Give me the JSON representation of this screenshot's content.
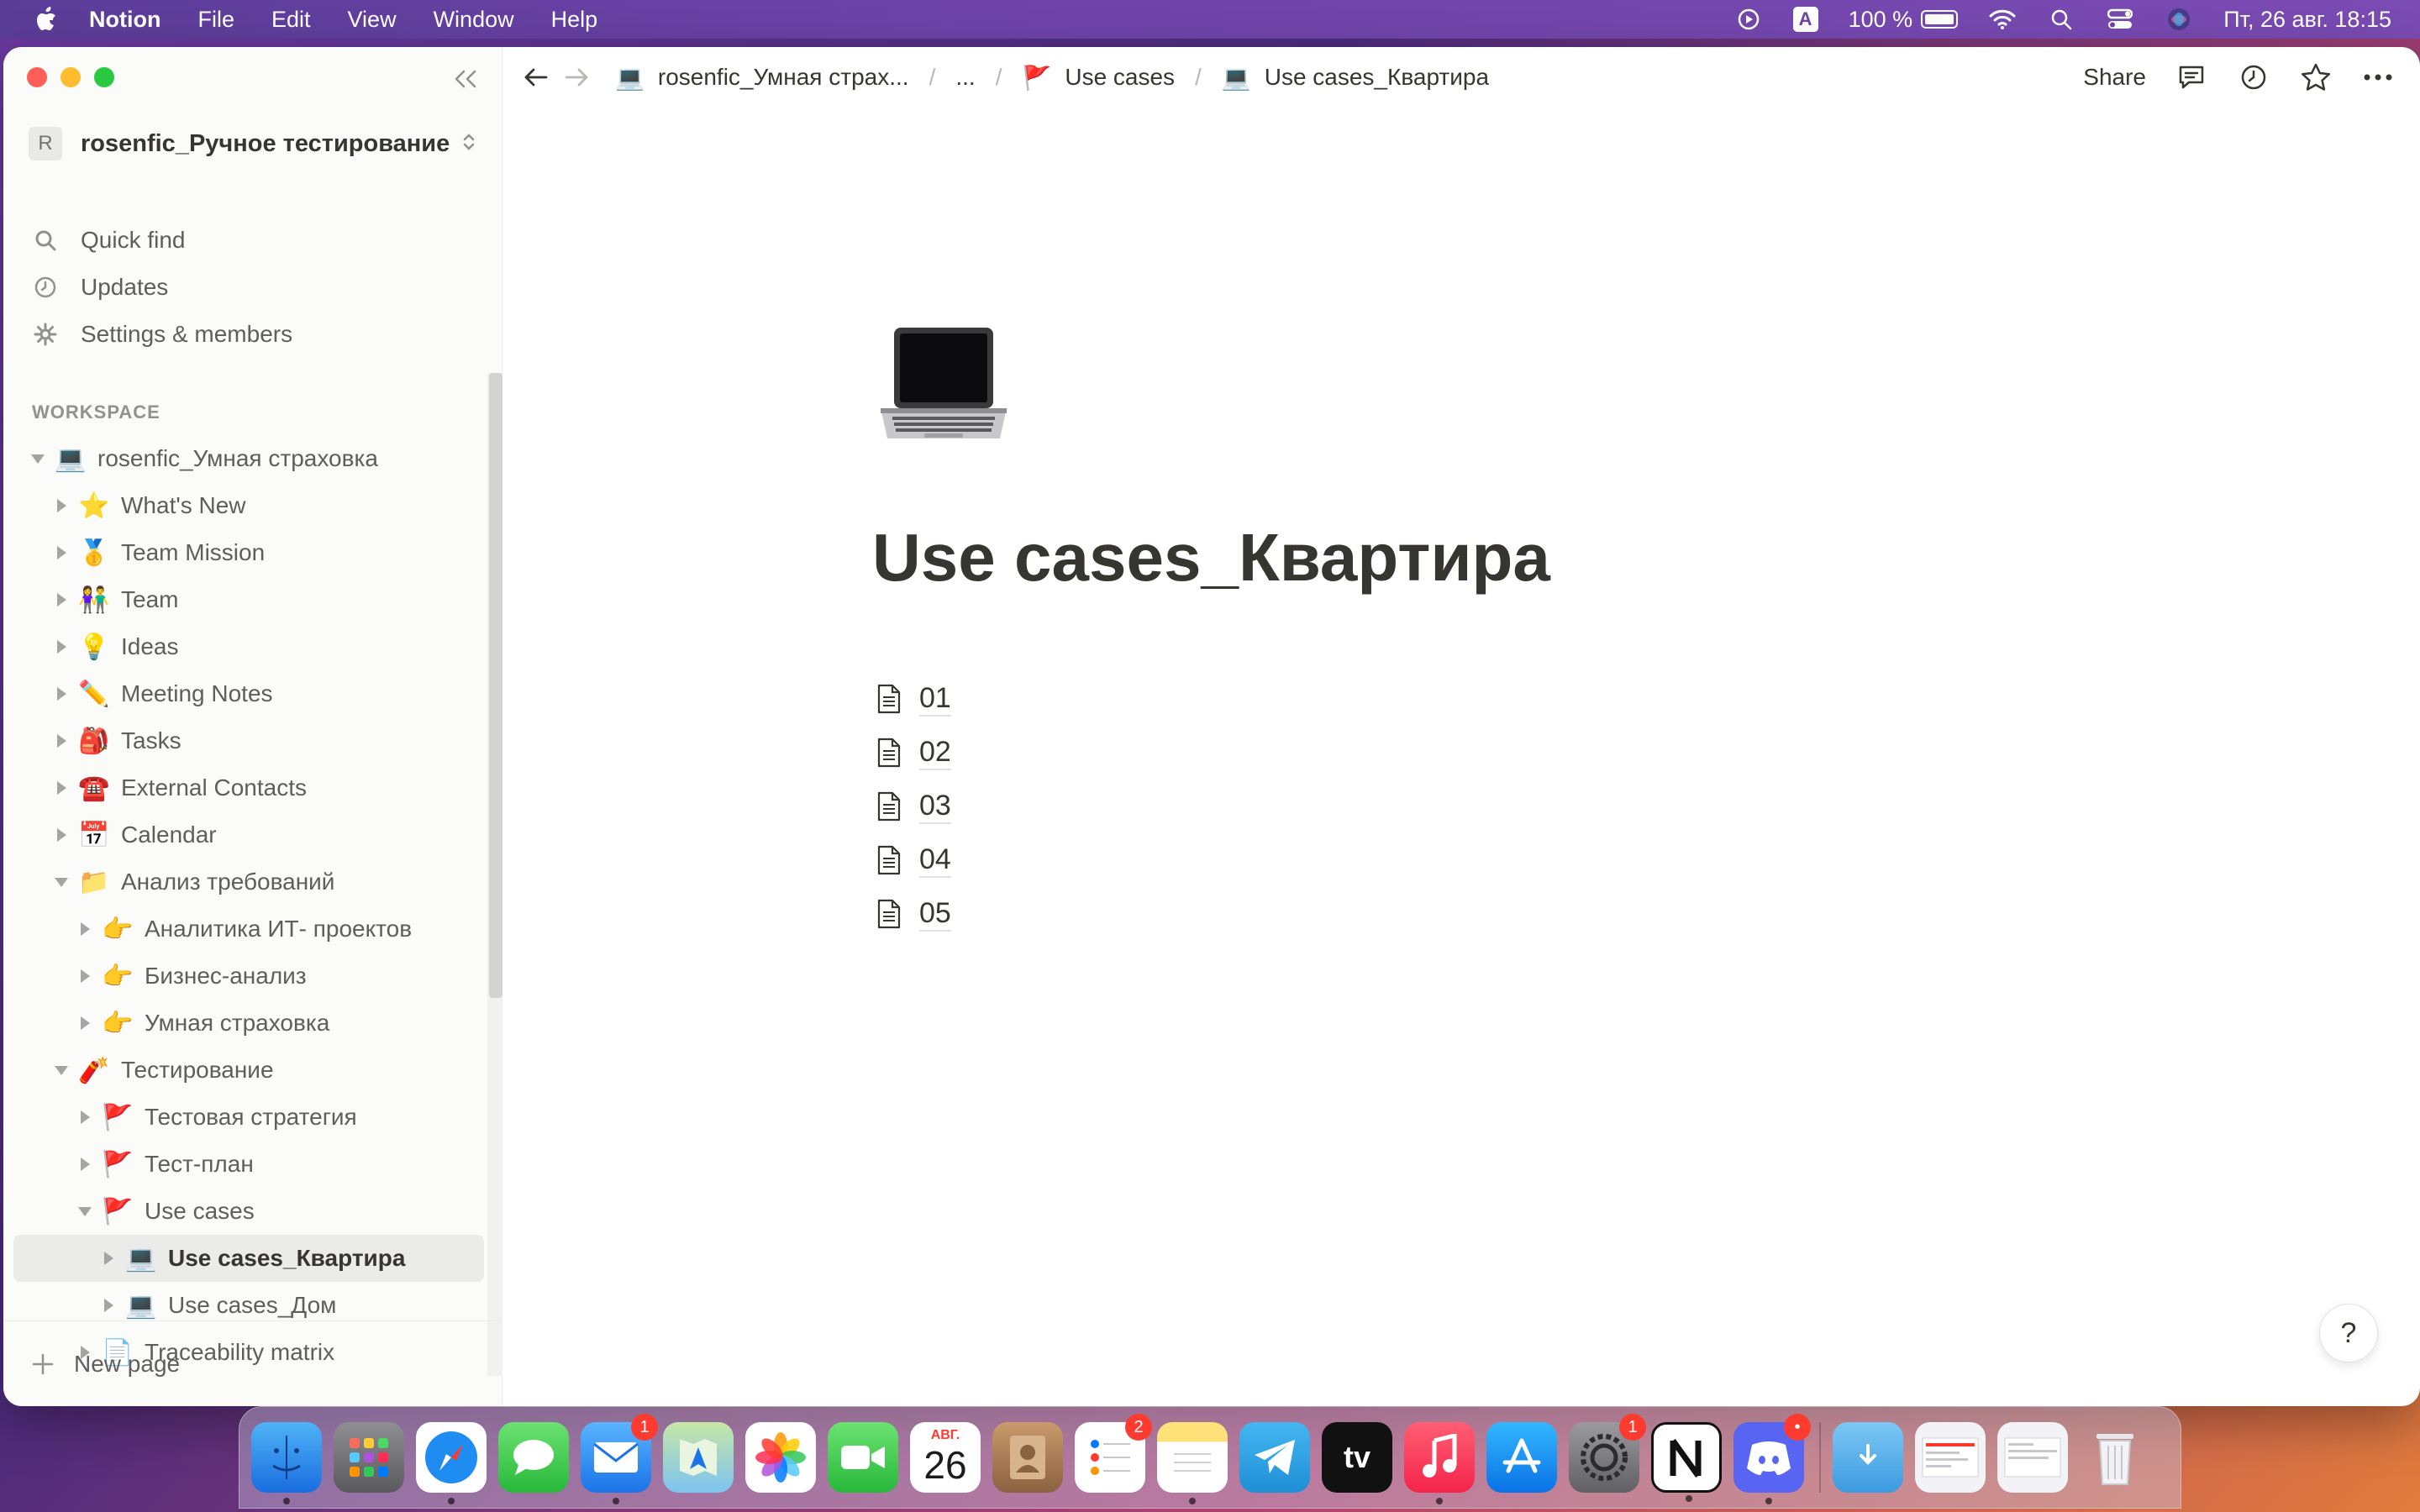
{
  "menubar": {
    "app_name": "Notion",
    "menus": [
      "File",
      "Edit",
      "View",
      "Window",
      "Help"
    ],
    "input_source": "A",
    "battery_percent": "100 %",
    "datetime": "Пт, 26 авг.  18:15"
  },
  "sidebar": {
    "workspace_avatar": "R",
    "workspace_name": "rosenfic_Ручное тестирование",
    "nav": [
      {
        "label": "Quick find",
        "icon": "search-icon"
      },
      {
        "label": "Updates",
        "icon": "clock-icon"
      },
      {
        "label": "Settings & members",
        "icon": "gear-icon"
      }
    ],
    "section_label": "WORKSPACE",
    "tree": [
      {
        "label": "rosenfic_Умная страховка",
        "emoji": "💻",
        "level": 0,
        "expanded": true
      },
      {
        "label": "What's New",
        "emoji": "⭐",
        "level": 1,
        "expanded": false
      },
      {
        "label": "Team Mission",
        "emoji": "🥇",
        "level": 1,
        "expanded": false
      },
      {
        "label": "Team",
        "emoji": "👫",
        "level": 1,
        "expanded": false
      },
      {
        "label": "Ideas",
        "emoji": "💡",
        "level": 1,
        "expanded": false
      },
      {
        "label": "Meeting Notes",
        "emoji": "✏️",
        "level": 1,
        "expanded": false
      },
      {
        "label": "Tasks",
        "emoji": "🎒",
        "level": 1,
        "expanded": false
      },
      {
        "label": "External Contacts",
        "emoji": "☎️",
        "level": 1,
        "expanded": false
      },
      {
        "label": "Calendar",
        "emoji": "📅",
        "level": 1,
        "expanded": false
      },
      {
        "label": "Анализ требований",
        "emoji": "📁",
        "level": 1,
        "expanded": true
      },
      {
        "label": "Аналитика ИТ- проектов",
        "emoji": "👉",
        "level": 2,
        "expanded": false
      },
      {
        "label": "Бизнес-анализ",
        "emoji": "👉",
        "level": 2,
        "expanded": false
      },
      {
        "label": "Умная страховка",
        "emoji": "👉",
        "level": 2,
        "expanded": false
      },
      {
        "label": "Тестирование",
        "emoji": "🧨",
        "level": 1,
        "expanded": true
      },
      {
        "label": "Тестовая стратегия",
        "emoji": "🚩",
        "level": 2,
        "expanded": false
      },
      {
        "label": "Тест-план",
        "emoji": "🚩",
        "level": 2,
        "expanded": false
      },
      {
        "label": "Use cases",
        "emoji": "🚩",
        "level": 2,
        "expanded": true
      },
      {
        "label": "Use cases_Квартира",
        "emoji": "💻",
        "level": 3,
        "expanded": false,
        "selected": true
      },
      {
        "label": "Use cases_Дом",
        "emoji": "💻",
        "level": 3,
        "expanded": false
      },
      {
        "label": "Traceability matrix",
        "emoji": "📄",
        "level": 2,
        "expanded": false
      }
    ],
    "new_page_label": "New page"
  },
  "topbar": {
    "breadcrumbs": [
      {
        "emoji": "💻",
        "label": "rosenfic_Умная страх..."
      },
      {
        "emoji": "",
        "label": "..."
      },
      {
        "emoji": "🚩",
        "label": "Use cases"
      },
      {
        "emoji": "💻",
        "label": "Use cases_Квартира"
      }
    ],
    "share_label": "Share"
  },
  "page": {
    "icon": "laptop-icon",
    "title": "Use cases_Квартира",
    "subpages": [
      "01",
      "02",
      "03",
      "04",
      "05"
    ],
    "help_label": "?"
  },
  "dock": {
    "calendar_month": "АВГ.",
    "calendar_day": "26",
    "tv_label": "tv",
    "badges": {
      "mail": "1",
      "reminders": "2",
      "settings": "1",
      "discord": "•"
    }
  }
}
